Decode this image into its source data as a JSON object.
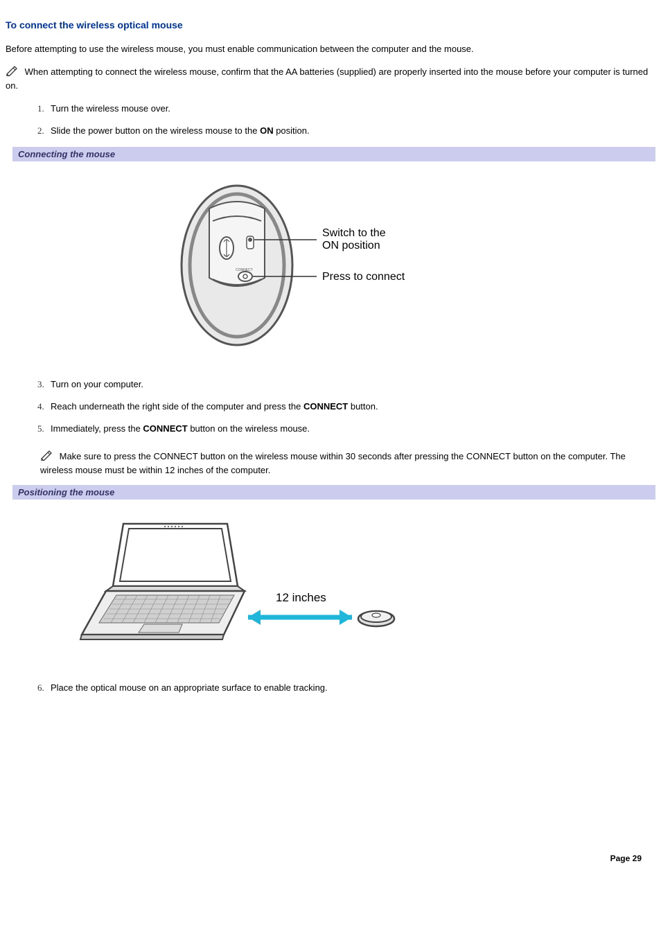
{
  "heading": "To connect the wireless optical mouse",
  "intro": "Before attempting to use the wireless mouse, you must enable communication between the computer and the mouse.",
  "note1": " When attempting to connect the wireless mouse, confirm that the AA batteries (supplied) are properly inserted into the mouse before your computer is turned on.",
  "steps": {
    "s1": "Turn the wireless mouse over.",
    "s2_a": "Slide the power button on the wireless mouse to the ",
    "s2_bold": "ON",
    "s2_b": " position.",
    "s3": "Turn on your computer.",
    "s4_a": "Reach underneath the right side of the computer and press the ",
    "s4_bold": "CONNECT",
    "s4_b": " button.",
    "s5_a": "Immediately, press the ",
    "s5_bold": "CONNECT",
    "s5_b": " button on the wireless mouse.",
    "s6": "Place the optical mouse on an appropriate surface to enable tracking."
  },
  "caption1": "Connecting the mouse",
  "caption2": "Positioning the mouse",
  "note2": " Make sure to press the CONNECT button on the wireless mouse within 30 seconds after pressing the CONNECT button on the computer. The wireless mouse must be within 12 inches of the computer.",
  "fig1": {
    "label_switch": "Switch to the",
    "label_switch2": "ON position",
    "label_press": "Press to connect"
  },
  "fig2": {
    "distance": "12 inches"
  },
  "footer": "Page 29"
}
